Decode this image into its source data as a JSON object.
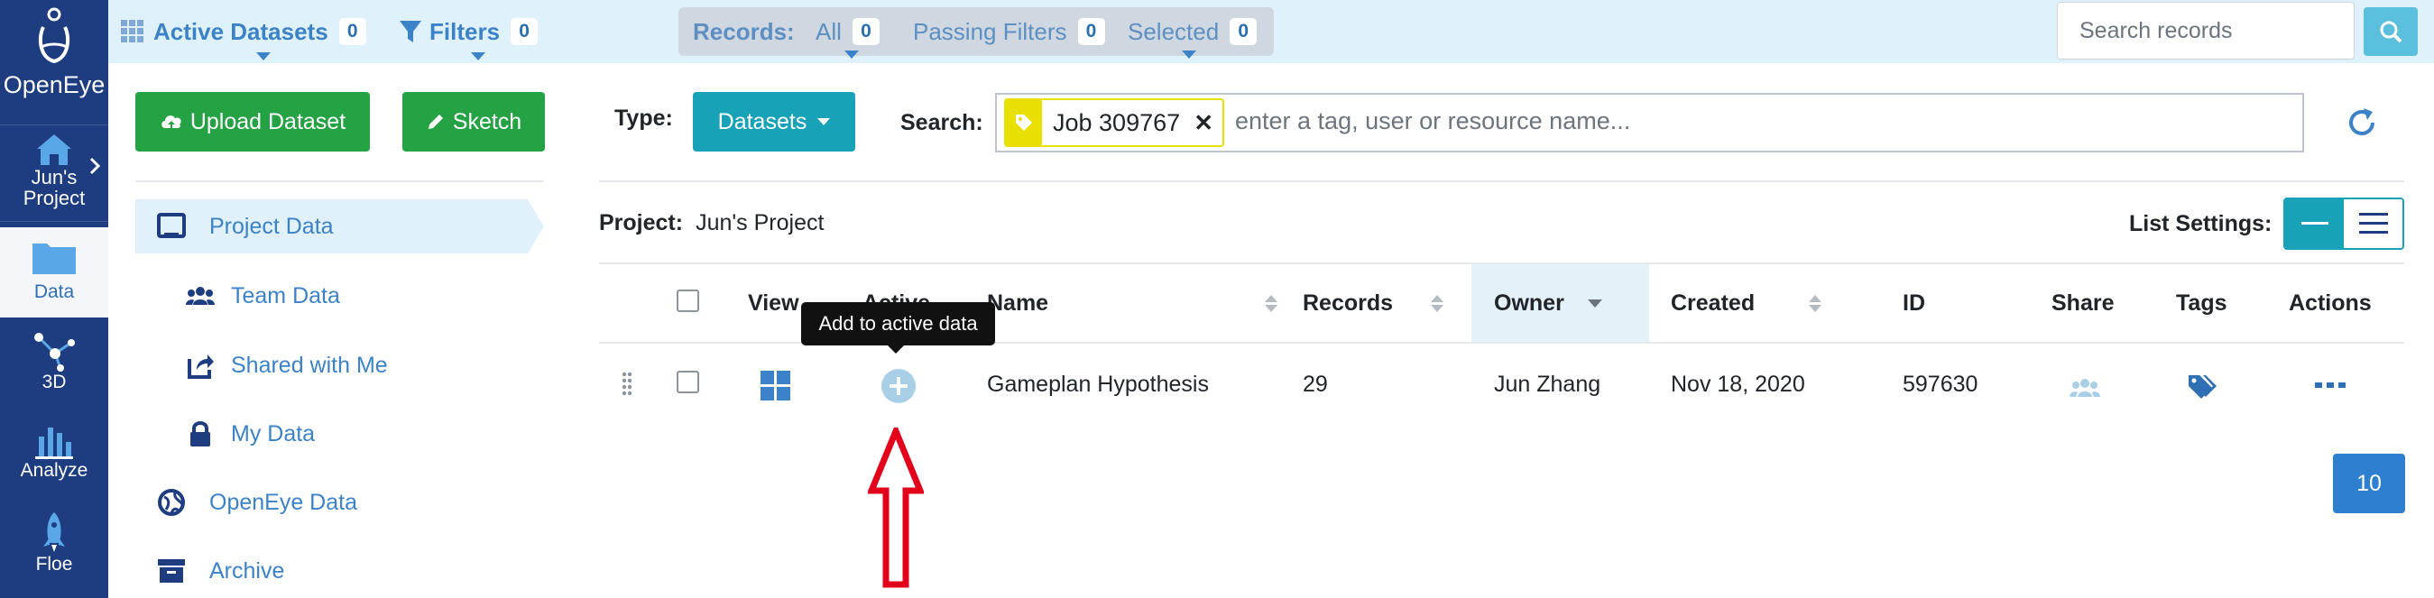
{
  "nav": {
    "brand": "OpenEye",
    "project_label": "Jun's Project",
    "items": [
      {
        "label": "Data",
        "icon": "folder-icon"
      },
      {
        "label": "3D",
        "icon": "molecule-icon"
      },
      {
        "label": "Analyze",
        "icon": "bar-chart-icon"
      },
      {
        "label": "Floe",
        "icon": "rocket-icon"
      }
    ]
  },
  "topbar": {
    "active_datasets": {
      "label": "Active Datasets",
      "count": "0"
    },
    "filters": {
      "label": "Filters",
      "count": "0"
    },
    "records": {
      "label": "Records:",
      "all": "All",
      "all_count": "0",
      "passing": "Passing Filters",
      "passing_count": "0",
      "selected": "Selected",
      "selected_count": "0"
    },
    "search_placeholder": "Search records"
  },
  "sidepanel": {
    "upload_label": "Upload Dataset",
    "sketch_label": "Sketch",
    "items": [
      {
        "label": "Project Data",
        "icon": "monitor-icon",
        "active": true
      },
      {
        "label": "Team Data",
        "icon": "team-icon"
      },
      {
        "label": "Shared with Me",
        "icon": "share-icon"
      },
      {
        "label": "My Data",
        "icon": "lock-icon"
      },
      {
        "label": "OpenEye Data",
        "icon": "globe-icon"
      },
      {
        "label": "Archive",
        "icon": "archive-icon"
      }
    ]
  },
  "main": {
    "type_label": "Type:",
    "type_value": "Datasets",
    "search_label": "Search:",
    "search_tag": "Job 309767",
    "search_placeholder": "enter a tag, user or resource name...",
    "project_label": "Project:",
    "project_name": "Jun's Project",
    "list_settings_label": "List Settings:",
    "columns": [
      "View",
      "Active",
      "Name",
      "Records",
      "Owner",
      "Created",
      "ID",
      "Share",
      "Tags",
      "Actions"
    ],
    "rows": [
      {
        "name": "Gameplan Hypothesis",
        "records": "29",
        "owner": "Jun Zhang",
        "created": "Nov 18, 2020",
        "id": "597630"
      }
    ],
    "tooltip": "Add to active data",
    "page_size": "10"
  },
  "colors": {
    "nav_bg": "#1e3d80",
    "topbar_bg": "#dff2fb",
    "green": "#25a244",
    "teal": "#17a2b8",
    "link_blue": "#3b82c8",
    "tag_yellow": "#e8e000",
    "annotation_red": "#e3001b"
  }
}
